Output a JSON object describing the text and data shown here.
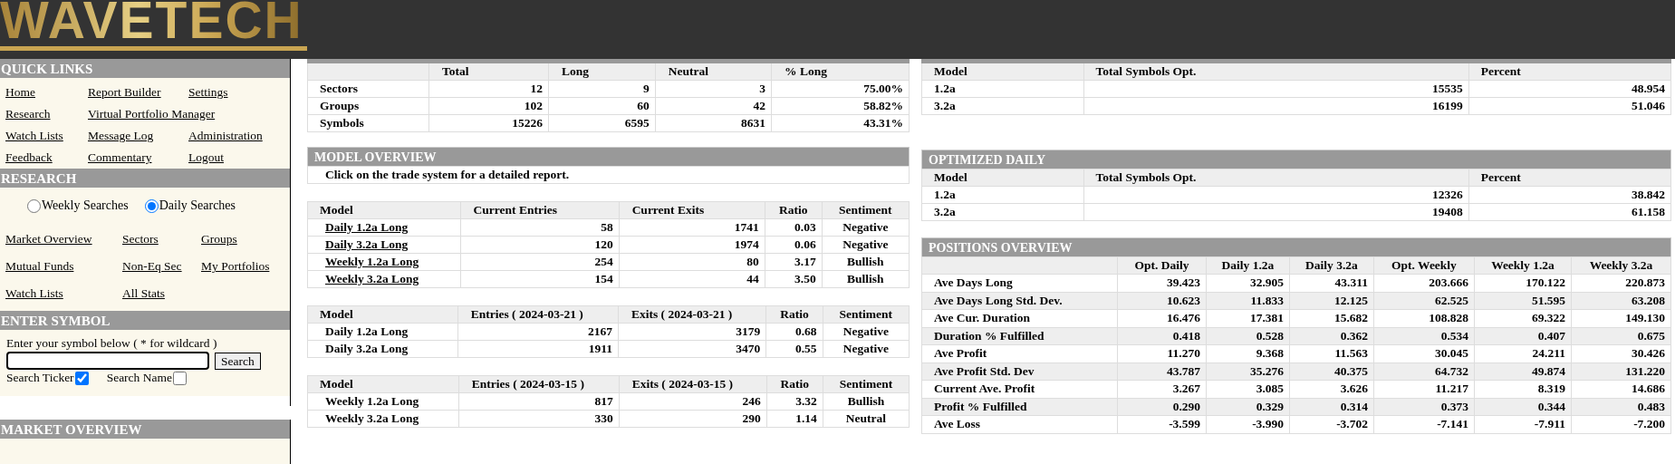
{
  "logo": {
    "text": "WAVETECH"
  },
  "sidebar": {
    "quick_links": {
      "title": "QUICK LINKS",
      "links": [
        [
          "Home",
          "Report Builder",
          "Settings"
        ],
        [
          "Research",
          "Virtual Portfolio Manager"
        ],
        [
          "Watch Lists",
          "Message Log",
          "Administration"
        ],
        [
          "Feedback",
          "Commentary",
          "Logout"
        ]
      ]
    },
    "research": {
      "title": "RESEARCH",
      "options": [
        {
          "label": "Weekly Searches",
          "selected": false
        },
        {
          "label": "Daily Searches",
          "selected": true
        }
      ],
      "links": [
        "Market Overview",
        "Sectors",
        "Groups",
        "Mutual Funds",
        "Non-Eq Sec",
        "My Portfolios",
        "Watch Lists",
        "All Stats"
      ]
    },
    "enter_symbol": {
      "title": "ENTER SYMBOL",
      "prompt": "Enter your symbol below ( * for wildcard )",
      "button": "Search",
      "checks": [
        {
          "label": "Search Ticker",
          "checked": true
        },
        {
          "label": "Search Name",
          "checked": false
        }
      ]
    },
    "market_overview": {
      "title": "MARKET OVERVIEW"
    }
  },
  "summary_table": {
    "columns": [
      "Total",
      "Long",
      "Neutral",
      "% Long"
    ],
    "rows": [
      {
        "label": "Sectors",
        "values": [
          "12",
          "9",
          "3",
          "75.00%"
        ]
      },
      {
        "label": "Groups",
        "values": [
          "102",
          "60",
          "42",
          "58.82%"
        ]
      },
      {
        "label": "Symbols",
        "values": [
          "15226",
          "6595",
          "8631",
          "43.31%"
        ]
      }
    ]
  },
  "model_overview": {
    "title": "MODEL OVERVIEW",
    "note": "Click on the trade system for a detailed report."
  },
  "model_tables": [
    {
      "linked": true,
      "columns": [
        "Model",
        "Current Entries",
        "Current Exits",
        "Ratio",
        "Sentiment"
      ],
      "rows": [
        [
          "Daily 1.2a Long",
          "58",
          "1741",
          "0.03",
          "Negative"
        ],
        [
          "Daily 3.2a Long",
          "120",
          "1974",
          "0.06",
          "Negative"
        ],
        [
          "Weekly 1.2a Long",
          "254",
          "80",
          "3.17",
          "Bullish"
        ],
        [
          "Weekly 3.2a Long",
          "154",
          "44",
          "3.50",
          "Bullish"
        ]
      ]
    },
    {
      "linked": false,
      "columns": [
        "Model",
        "Entries ( 2024-03-21 )",
        "Exits ( 2024-03-21 )",
        "Ratio",
        "Sentiment"
      ],
      "rows": [
        [
          "Daily 1.2a Long",
          "2167",
          "3179",
          "0.68",
          "Negative"
        ],
        [
          "Daily 3.2a Long",
          "1911",
          "3470",
          "0.55",
          "Negative"
        ]
      ]
    },
    {
      "linked": false,
      "columns": [
        "Model",
        "Entries ( 2024-03-15 )",
        "Exits ( 2024-03-15 )",
        "Ratio",
        "Sentiment"
      ],
      "rows": [
        [
          "Weekly 1.2a Long",
          "817",
          "246",
          "3.32",
          "Bullish"
        ],
        [
          "Weekly 3.2a Long",
          "330",
          "290",
          "1.14",
          "Neutral"
        ]
      ]
    }
  ],
  "opt_table": {
    "columns": [
      "Model",
      "Total Symbols Opt.",
      "Percent"
    ],
    "rows": [
      [
        "1.2a",
        "15535",
        "48.954"
      ],
      [
        "3.2a",
        "16199",
        "51.046"
      ]
    ]
  },
  "optimized_daily": {
    "title": "OPTIMIZED DAILY",
    "columns": [
      "Model",
      "Total Symbols Opt.",
      "Percent"
    ],
    "rows": [
      [
        "1.2a",
        "12326",
        "38.842"
      ],
      [
        "3.2a",
        "19408",
        "61.158"
      ]
    ]
  },
  "positions_overview": {
    "title": "POSITIONS OVERVIEW",
    "columns": [
      "Opt. Daily",
      "Daily 1.2a",
      "Daily 3.2a",
      "Opt. Weekly",
      "Weekly 1.2a",
      "Weekly 3.2a"
    ],
    "rows": [
      {
        "label": "Ave Days Long",
        "values": [
          "39.423",
          "32.905",
          "43.311",
          "203.666",
          "170.122",
          "220.873"
        ]
      },
      {
        "label": "Ave Days Long Std. Dev.",
        "values": [
          "10.623",
          "11.833",
          "12.125",
          "62.525",
          "51.595",
          "63.208"
        ]
      },
      {
        "label": "Ave Cur. Duration",
        "values": [
          "16.476",
          "17.381",
          "15.682",
          "108.828",
          "69.322",
          "149.130"
        ]
      },
      {
        "label": "Duration % Fulfilled",
        "values": [
          "0.418",
          "0.528",
          "0.362",
          "0.534",
          "0.407",
          "0.675"
        ]
      },
      {
        "label": "Ave Profit",
        "values": [
          "11.270",
          "9.368",
          "11.563",
          "30.045",
          "24.211",
          "30.426"
        ]
      },
      {
        "label": "Ave Profit Std. Dev",
        "values": [
          "43.787",
          "35.276",
          "40.375",
          "64.732",
          "49.874",
          "131.220"
        ]
      },
      {
        "label": "Current Ave. Profit",
        "values": [
          "3.267",
          "3.085",
          "3.626",
          "11.217",
          "8.319",
          "14.686"
        ]
      },
      {
        "label": "Profit % Fulfilled",
        "values": [
          "0.290",
          "0.329",
          "0.314",
          "0.373",
          "0.344",
          "0.483"
        ]
      },
      {
        "label": "Ave Loss",
        "values": [
          "-3.599",
          "-3.990",
          "-3.702",
          "-7.141",
          "-7.911",
          "-7.200"
        ]
      }
    ]
  }
}
